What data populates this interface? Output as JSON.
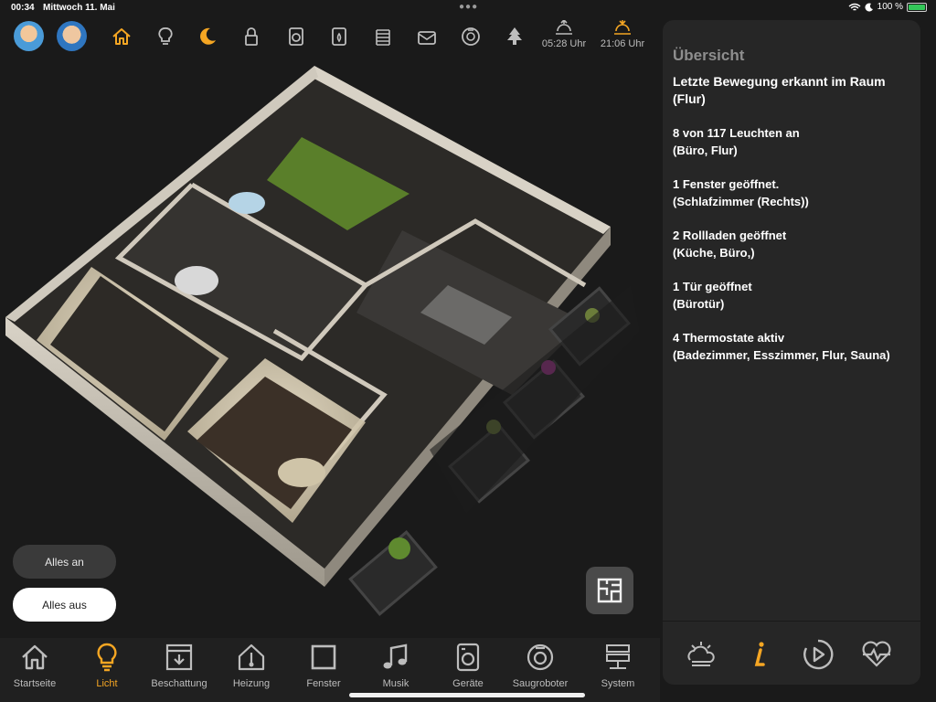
{
  "status": {
    "time": "00:34",
    "date": "Mittwoch 11. Mai",
    "battery": "100 %"
  },
  "topnav": {
    "icons": [
      "home-icon",
      "bulb-icon",
      "moon-icon",
      "lock-icon",
      "washer-icon",
      "dryer-icon",
      "radiator-icon",
      "mailbox-icon",
      "robot-vacuum-icon",
      "tree-icon"
    ],
    "sunrise": "05:28 Uhr",
    "sunset": "21:06 Uhr"
  },
  "controls": {
    "all_on": "Alles an",
    "all_off": "Alles aus"
  },
  "panel": {
    "title": "Übersicht",
    "items": [
      {
        "line1": "Letzte Bewegung erkannt im Raum",
        "line2": "(Flur)"
      },
      {
        "line1": "8 von 117 Leuchten an",
        "line2": "(Büro, Flur)"
      },
      {
        "line1": "1 Fenster geöffnet.",
        "line2": "(Schlafzimmer (Rechts))"
      },
      {
        "line1": "2 Rollladen geöffnet",
        "line2": "(Küche, Büro,)"
      },
      {
        "line1": "1 Tür geöffnet",
        "line2": "(Bürotür)"
      },
      {
        "line1": "4 Thermostate aktiv",
        "line2": "(Badezimmer, Esszimmer, Flur, Sauna)"
      }
    ],
    "tabs": [
      "weather-icon",
      "info-icon",
      "play-clock-icon",
      "heartbeat-icon"
    ]
  },
  "bottomnav": [
    {
      "label": "Startseite",
      "icon": "home-icon"
    },
    {
      "label": "Licht",
      "icon": "bulb-icon"
    },
    {
      "label": "Beschattung",
      "icon": "shutter-icon"
    },
    {
      "label": "Heizung",
      "icon": "thermo-house-icon"
    },
    {
      "label": "Fenster",
      "icon": "window-icon"
    },
    {
      "label": "Musik",
      "icon": "music-icon"
    },
    {
      "label": "Geräte",
      "icon": "washer-icon"
    },
    {
      "label": "Saugroboter",
      "icon": "robot-vacuum-icon"
    },
    {
      "label": "System",
      "icon": "server-icon"
    }
  ],
  "colors": {
    "accent": "#f5a623",
    "background": "#1a1a1a",
    "panel": "#262626"
  }
}
